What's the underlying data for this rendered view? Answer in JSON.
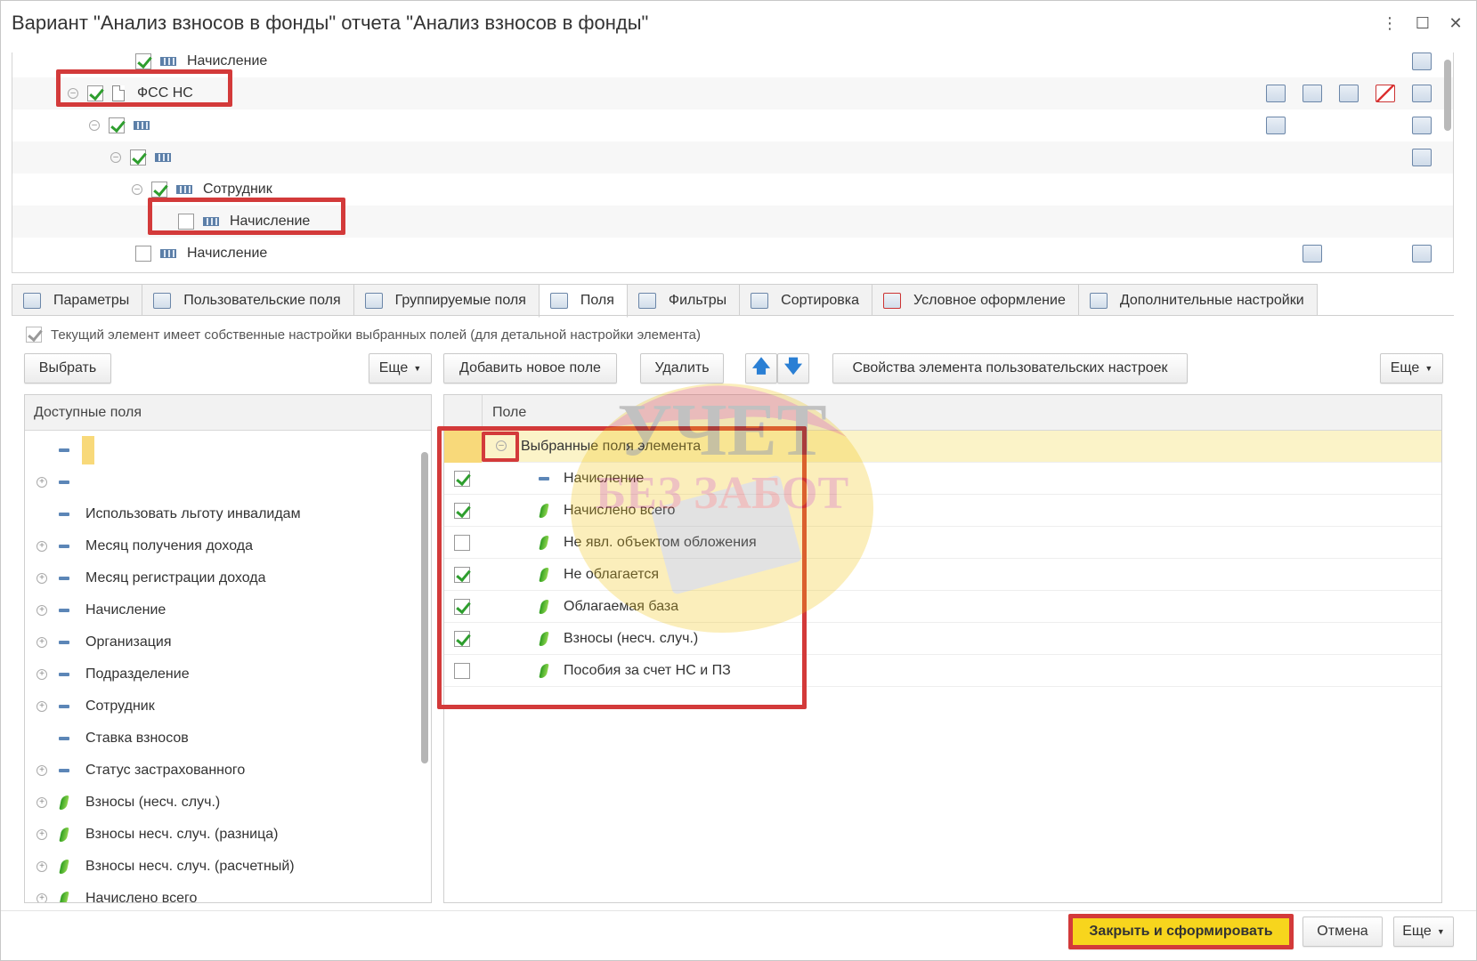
{
  "window": {
    "title": "Вариант \"Анализ взносов в фонды\" отчета \"Анализ взносов в фонды\"",
    "menu_icon": "⋮",
    "maximize_icon": "☐",
    "close_icon": "✕"
  },
  "tree": {
    "rows": [
      {
        "label": "Начисление",
        "checked": true
      },
      {
        "label": "ФСС НС",
        "checked": true
      },
      {
        "label": "",
        "checked": true
      },
      {
        "label": "",
        "checked": true
      },
      {
        "label": "Сотрудник",
        "checked": true
      },
      {
        "label": "Начисление",
        "checked": false
      },
      {
        "label": "Начисление",
        "checked": false
      }
    ]
  },
  "tabs": [
    {
      "label": "Параметры"
    },
    {
      "label": "Пользовательские поля"
    },
    {
      "label": "Группируемые поля"
    },
    {
      "label": "Поля",
      "active": true
    },
    {
      "label": "Фильтры"
    },
    {
      "label": "Сортировка"
    },
    {
      "label": "Условное оформление"
    },
    {
      "label": "Дополнительные настройки"
    }
  ],
  "own_settings_text": "Текущий элемент имеет собственные настройки выбранных полей (для детальной настройки элемента)",
  "toolbar": {
    "select_label": "Выбрать",
    "more_left_label": "Еще",
    "add_field_label": "Добавить новое поле",
    "delete_label": "Удалить",
    "up_icon": "arrow-up-icon",
    "down_icon": "arrow-down-icon",
    "properties_label": "Свойства элемента пользовательских настроек",
    "more_right_label": "Еще"
  },
  "available": {
    "header": "Доступные поля",
    "items": [
      {
        "label": "",
        "expand": false,
        "kind": "field"
      },
      {
        "label": "",
        "expand": true,
        "kind": "field"
      },
      {
        "label": "Использовать льготу инвалидам",
        "expand": false,
        "kind": "field"
      },
      {
        "label": "Месяц получения дохода",
        "expand": true,
        "kind": "field"
      },
      {
        "label": "Месяц регистрации дохода",
        "expand": true,
        "kind": "field"
      },
      {
        "label": "Начисление",
        "expand": true,
        "kind": "field"
      },
      {
        "label": "Организация",
        "expand": true,
        "kind": "field"
      },
      {
        "label": "Подразделение",
        "expand": true,
        "kind": "field"
      },
      {
        "label": "Сотрудник",
        "expand": true,
        "kind": "field"
      },
      {
        "label": "Ставка взносов",
        "expand": false,
        "kind": "field"
      },
      {
        "label": "Статус застрахованного",
        "expand": true,
        "kind": "field"
      },
      {
        "label": "Взносы (несч. случ.)",
        "expand": true,
        "kind": "resource"
      },
      {
        "label": "Взносы несч. случ. (разница)",
        "expand": true,
        "kind": "resource"
      },
      {
        "label": "Взносы несч. случ. (расчетный)",
        "expand": true,
        "kind": "resource"
      },
      {
        "label": "Начислено всего",
        "expand": true,
        "kind": "resource"
      }
    ]
  },
  "selected": {
    "header": "Поле",
    "group_label": "Выбранные поля элемента",
    "items": [
      {
        "label": "Начисление",
        "checked": true,
        "kind": "field"
      },
      {
        "label": "Начислено всего",
        "checked": true,
        "kind": "resource"
      },
      {
        "label": "Не явл. объектом обложения",
        "checked": false,
        "kind": "resource"
      },
      {
        "label": "Не облагается",
        "checked": true,
        "kind": "resource"
      },
      {
        "label": "Облагаемая база",
        "checked": true,
        "kind": "resource"
      },
      {
        "label": "Взносы (несч. случ.)",
        "checked": true,
        "kind": "resource"
      },
      {
        "label": "Пособия за счет НС и ПЗ",
        "checked": false,
        "kind": "resource"
      }
    ]
  },
  "watermark": {
    "line1": "УЧЕТ",
    "line2": "БЕЗ ЗАБОТ"
  },
  "footer": {
    "generate_label": "Закрыть и сформировать",
    "cancel_label": "Отмена",
    "more_label": "Еще"
  },
  "colors": {
    "accent_yellow": "#f7d51d",
    "highlight_red": "#d33a3a",
    "check_green": "#2e9e2e"
  }
}
